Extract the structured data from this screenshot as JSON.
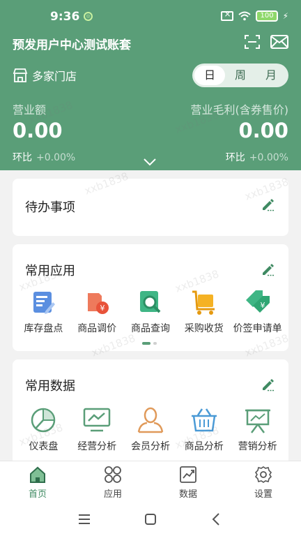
{
  "status_bar": {
    "time": "9:36",
    "battery": "100"
  },
  "header": {
    "title": "预发用户中心测试账套",
    "store_label": "多家门店",
    "period_options": [
      "日",
      "周",
      "月"
    ],
    "active_period": "日",
    "metrics": {
      "left": {
        "label": "营业额",
        "value": "0.00",
        "compare_label": "环比",
        "compare_value": "+0.00%"
      },
      "right": {
        "label": "营业毛利(含券售价)",
        "value": "0.00",
        "compare_label": "环比",
        "compare_value": "+0.00%"
      }
    }
  },
  "todo_card": {
    "title": "待办事项"
  },
  "apps_card": {
    "title": "常用应用",
    "items": [
      {
        "label": "库存盘点",
        "icon": "inventory-count-icon"
      },
      {
        "label": "商品调价",
        "icon": "price-adjust-icon"
      },
      {
        "label": "商品查询",
        "icon": "product-search-icon"
      },
      {
        "label": "采购收货",
        "icon": "purchase-receive-icon"
      },
      {
        "label": "价签申请单",
        "icon": "price-tag-icon"
      }
    ]
  },
  "data_card": {
    "title": "常用数据",
    "items": [
      {
        "label": "仪表盘",
        "icon": "dashboard-icon"
      },
      {
        "label": "经营分析",
        "icon": "business-analysis-icon"
      },
      {
        "label": "会员分析",
        "icon": "member-analysis-icon"
      },
      {
        "label": "商品分析",
        "icon": "product-analysis-icon"
      },
      {
        "label": "营销分析",
        "icon": "marketing-analysis-icon"
      }
    ]
  },
  "tabbar": {
    "items": [
      {
        "label": "首页",
        "icon": "home-icon",
        "active": true
      },
      {
        "label": "应用",
        "icon": "apps-icon",
        "active": false
      },
      {
        "label": "数据",
        "icon": "data-icon",
        "active": false
      },
      {
        "label": "设置",
        "icon": "settings-icon",
        "active": false
      }
    ]
  },
  "watermark": "xxb1838",
  "colors": {
    "brand_green": "#5a9e78",
    "active_tab": "#3f8a62",
    "background": "#f2f2f2"
  }
}
